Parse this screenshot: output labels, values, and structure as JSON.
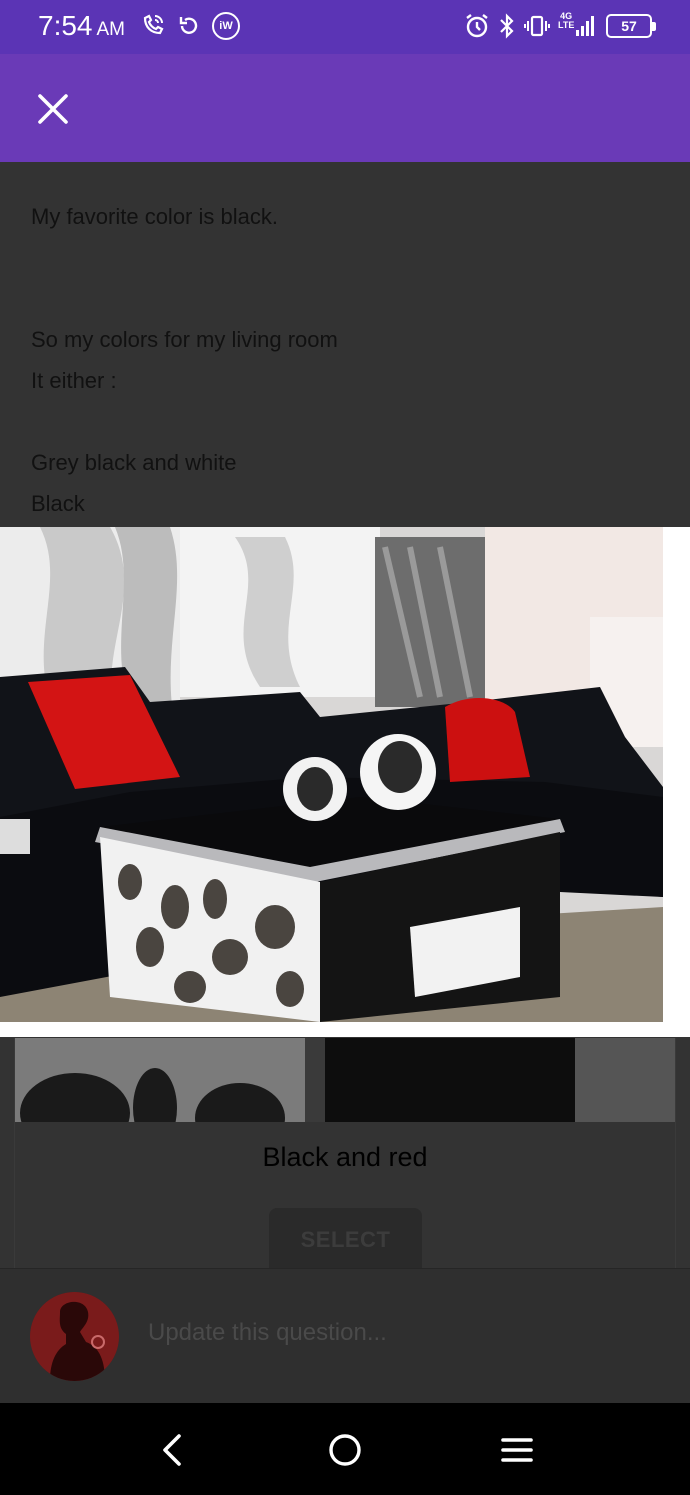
{
  "status_bar": {
    "time": "7:54",
    "ampm": "AM",
    "iw_badge": "iW",
    "network_label_top": "4G",
    "network_label_bottom": "LTE",
    "battery": "57",
    "icons": [
      "phone-wifi-icon",
      "sync-icon",
      "iw-icon",
      "alarm-icon",
      "bluetooth-icon",
      "vibrate-icon",
      "signal-icon",
      "battery-icon"
    ]
  },
  "app_bar": {
    "close_icon": "close-icon"
  },
  "question": {
    "lines": [
      "My favorite color is black.",
      "",
      "",
      "So my colors for my living room",
      "It either :",
      "",
      "Grey black and white",
      "Black"
    ]
  },
  "option": {
    "label": "Black and red",
    "select_label": "SELECT"
  },
  "composer": {
    "placeholder": "Update this question..."
  },
  "nav": {
    "back_icon": "back-icon",
    "home_icon": "home-icon",
    "menu_icon": "menu-icon"
  },
  "colors": {
    "status_bar": "#5b34b5",
    "app_bar": "#6a3ab7",
    "overlay_bg": "#333333"
  }
}
